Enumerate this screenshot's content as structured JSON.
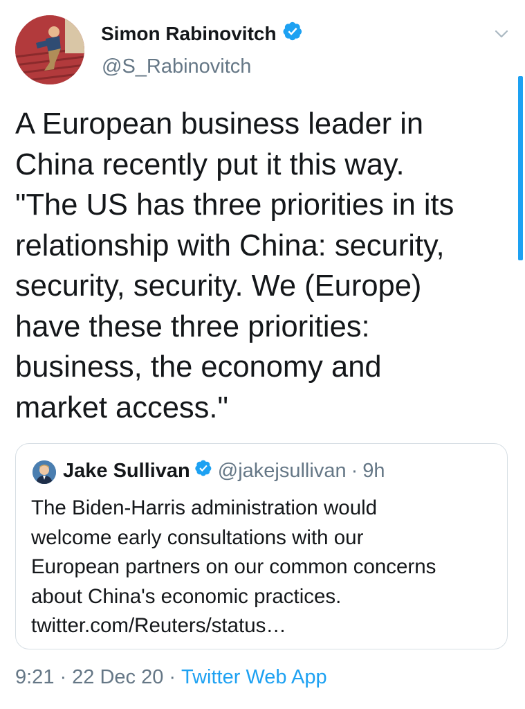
{
  "author": {
    "name": "Simon Rabinovitch",
    "handle": "@S_Rabinovitch",
    "verified": true
  },
  "tweet": {
    "text_lines": [
      "A European business leader in",
      "China recently put it this way.",
      "\"The US has three priorities in its",
      "relationship with China: security,",
      "security, security. We (Europe)",
      "have these three priorities:",
      "business, the economy and",
      "market access.\""
    ]
  },
  "quoted_tweet": {
    "name": "Jake Sullivan",
    "handle": "@jakejsullivan",
    "separator": "·",
    "time": "9h",
    "verified": true,
    "text_lines": [
      "The Biden-Harris administration would",
      "welcome early consultations with our",
      "European partners on our common concerns",
      "about China's economic practices.",
      "twitter.com/Reuters/status…"
    ]
  },
  "meta": {
    "time": "9:21",
    "separator": "·",
    "date": "22 Dec 20",
    "source": "Twitter Web App"
  },
  "icons": {
    "verified": "verified-badge-icon",
    "more": "chevron-down-icon"
  },
  "colors": {
    "accent": "#1da1f2",
    "text_primary": "#14171a",
    "text_secondary": "#657786",
    "border": "#d6dee4"
  }
}
